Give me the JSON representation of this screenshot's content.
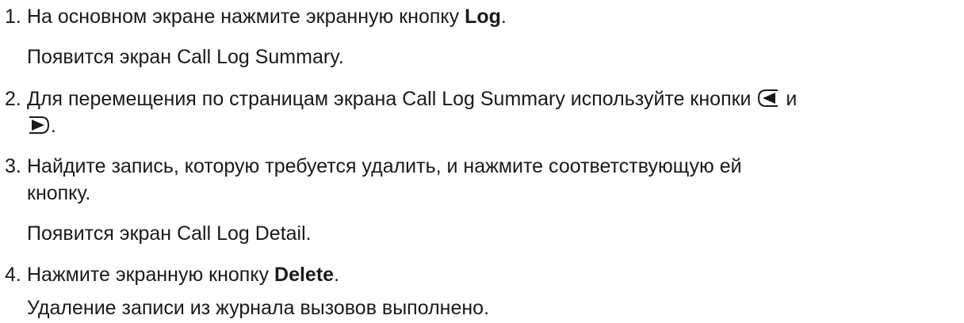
{
  "steps": [
    {
      "number": "1.",
      "text_before": "На основном экране нажмите экранную кнопку ",
      "bold": "Log",
      "text_after": ".",
      "result": "Появится экран Call Log Summary."
    },
    {
      "number": "2.",
      "text_before": "Для перемещения по страницам экрана Call Log Summary используйте кнопки",
      "connector": "и",
      "text_after": ".",
      "icons": [
        "left-arrow-key-icon",
        "right-arrow-key-icon"
      ]
    },
    {
      "number": "3.",
      "text_line1": "Найдите запись, которую требуется удалить, и нажмите соответствующую ей",
      "text_line2": "кнопку.",
      "result": "Появится экран Call Log Detail."
    },
    {
      "number": "4.",
      "text_before": "Нажмите экранную кнопку ",
      "bold": "Delete",
      "text_after": ".",
      "result": "Удаление записи из журнала вызовов выполнено."
    }
  ],
  "colors": {
    "text": "#1a1a1a",
    "background": "#ffffff"
  }
}
